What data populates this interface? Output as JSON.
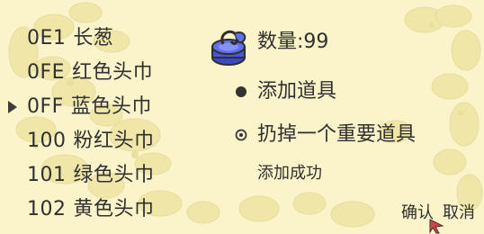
{
  "items": [
    {
      "code": "",
      "name": ""
    },
    {
      "code": "0E1",
      "name": "长葱"
    },
    {
      "code": "0FE",
      "name": "红色头巾"
    },
    {
      "code": "0FF",
      "name": "蓝色头巾"
    },
    {
      "code": "100",
      "name": "粉红头巾"
    },
    {
      "code": "101",
      "name": "绿色头巾"
    },
    {
      "code": "102",
      "name": "黄色头巾"
    }
  ],
  "quantity": {
    "label": "数量:",
    "value": "99"
  },
  "menu": {
    "add_item": "添加道具",
    "discard_key_item": "扔掉一个重要道具"
  },
  "status": {
    "message": "添加成功"
  },
  "actions": {
    "confirm": "确认",
    "cancel": "取消"
  },
  "icons": {
    "item_icon": "blue-ring-item-icon",
    "cursor": "selection-arrow-icon",
    "bullet_filled": "filled-circle-bullet-icon",
    "bullet_ring": "ring-circle-bullet-icon",
    "pointer": "red-pointer-icon"
  },
  "colors": {
    "background": "#fbf3c9",
    "flower": "#efe6a7",
    "text": "#303030",
    "item_blue": "#4a56d3",
    "pointer_red": "#d14747"
  }
}
